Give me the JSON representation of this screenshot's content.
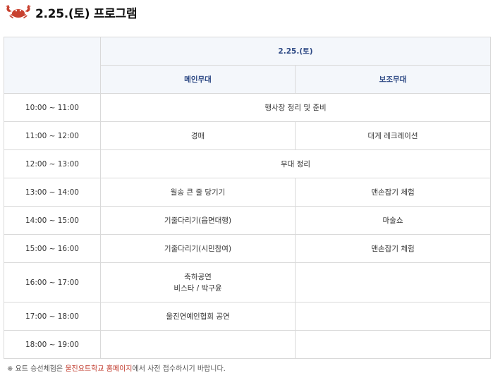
{
  "header": {
    "title": "2.25.(토) 프로그램",
    "icon": "crab-icon",
    "icon_color": "#c8412f"
  },
  "table": {
    "date_header": "2.25.(토)",
    "columns": [
      "메인무대",
      "보조무대"
    ],
    "rows": [
      {
        "time": "10:00 ~ 11:00",
        "merged": "행사장 정리 및 준비"
      },
      {
        "time": "11:00 ~ 12:00",
        "main": "경매",
        "sub": "대게 레크레이션"
      },
      {
        "time": "12:00 ~ 13:00",
        "merged": "무대 정리"
      },
      {
        "time": "13:00 ~ 14:00",
        "main": "월송 큰 줄 당기기",
        "sub": "맨손잡기 체험"
      },
      {
        "time": "14:00 ~ 15:00",
        "main": "기줄다리기(읍면대행)",
        "sub": "마술쇼"
      },
      {
        "time": "15:00 ~ 16:00",
        "main": "기줄다리기(시민참여)",
        "sub": "맨손잡기 체험"
      },
      {
        "time": "16:00 ~ 17:00",
        "main_line1": "축하공연",
        "main_line2": "비스타 / 박구윤",
        "sub": ""
      },
      {
        "time": "17:00 ~ 18:00",
        "main": "울진연예인협회 공연",
        "sub": ""
      },
      {
        "time": "18:00 ~ 19:00",
        "main": "",
        "sub": ""
      }
    ]
  },
  "footnote": {
    "prefix": "※ 요트 승선체험은 ",
    "link": "울진요트학교 홈페이지",
    "suffix": "에서 사전 접수하시기 바랍니다."
  },
  "colors": {
    "header_text": "#2e4a85",
    "header_bg": "#f4f7fb",
    "link": "#c0392b"
  }
}
